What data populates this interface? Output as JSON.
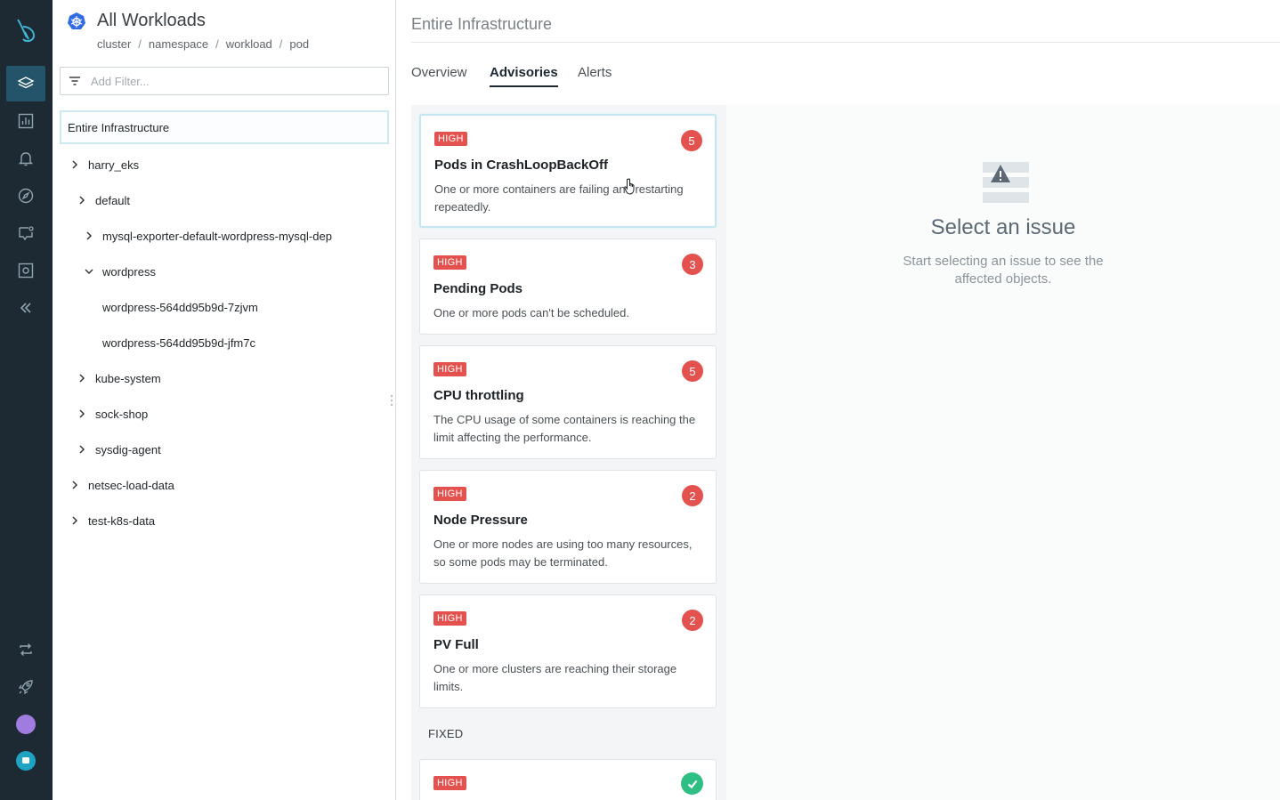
{
  "rail": {
    "items": [
      {
        "icon": "layers-icon",
        "active": true
      },
      {
        "icon": "dashboard-chart-icon",
        "active": false
      },
      {
        "icon": "alert-bell-icon",
        "active": false
      },
      {
        "icon": "explore-compass-icon",
        "active": false
      },
      {
        "icon": "events-chat-icon",
        "active": false
      },
      {
        "icon": "capture-camera-icon",
        "active": false
      },
      {
        "icon": "collapse-double-chevron-icon",
        "active": false
      }
    ],
    "bottom": [
      {
        "icon": "integrations-arrows-icon"
      },
      {
        "icon": "rocket-icon"
      }
    ],
    "user_color": "#a07ce0",
    "help_color": "#1fa3c3"
  },
  "workloads": {
    "title": "All Workloads",
    "breadcrumbs": [
      "cluster",
      "namespace",
      "workload",
      "pod"
    ],
    "filter_placeholder": "Add Filter...",
    "selected": "Entire Infrastructure",
    "tree": [
      {
        "label": "harry_eks",
        "state": "collapsed"
      },
      {
        "label": "default",
        "state": "collapsed"
      },
      {
        "label": "mysql-exporter-default-wordpress-mysql-dep",
        "state": "collapsed"
      },
      {
        "label": "wordpress",
        "state": "expanded"
      },
      {
        "label": "wordpress-564dd95b9d-7zjvm",
        "state": "leaf"
      },
      {
        "label": "wordpress-564dd95b9d-jfm7c",
        "state": "leaf"
      },
      {
        "label": "kube-system",
        "state": "collapsed"
      },
      {
        "label": "sock-shop",
        "state": "collapsed"
      },
      {
        "label": "sysdig-agent",
        "state": "collapsed"
      },
      {
        "label": "netsec-load-data",
        "state": "collapsed"
      },
      {
        "label": "test-k8s-data",
        "state": "collapsed"
      }
    ]
  },
  "main": {
    "title": "Entire Infrastructure",
    "tabs": [
      "Overview",
      "Advisories",
      "Alerts"
    ],
    "active_tab": "Advisories",
    "issues": [
      {
        "severity": "HIGH",
        "count": "5",
        "title": "Pods in CrashLoopBackOff",
        "description": "One or more containers are failing and restarting repeatedly."
      },
      {
        "severity": "HIGH",
        "count": "3",
        "title": "Pending Pods",
        "description": "One or more pods can't be scheduled."
      },
      {
        "severity": "HIGH",
        "count": "5",
        "title": "CPU throttling",
        "description": "The CPU usage of some containers is reaching the limit affecting the performance."
      },
      {
        "severity": "HIGH",
        "count": "2",
        "title": "Node Pressure",
        "description": "One or more nodes are using too many resources, so some pods may be terminated."
      },
      {
        "severity": "HIGH",
        "count": "2",
        "title": "PV Full",
        "description": "One or more clusters are reaching their storage limits."
      }
    ],
    "fixed_label": "FIXED",
    "fixed_issues": [
      {
        "severity": "HIGH",
        "status": "check-circle-icon"
      }
    ],
    "empty_state": {
      "title": "Select an issue",
      "text": "Start selecting an issue to see the affected objects."
    }
  },
  "colors": {
    "rail_bg": "#1d2a33",
    "rail_active": "#24546a",
    "high_severity": "#e3524f",
    "fixed_ok": "#2fbf85",
    "accent_kubernetes": "#326ce5"
  }
}
